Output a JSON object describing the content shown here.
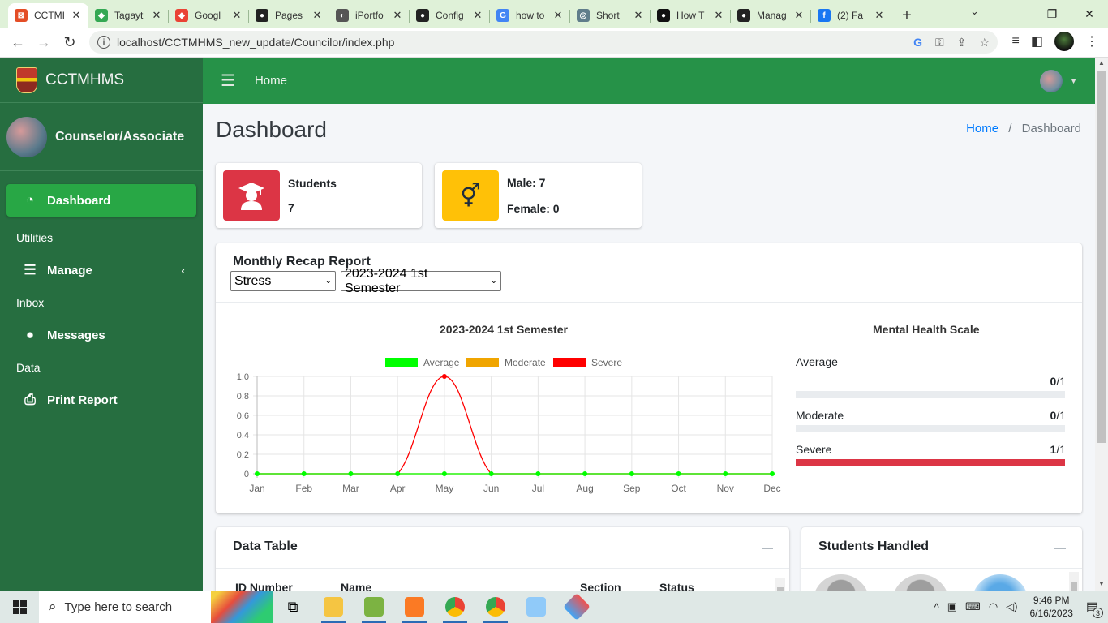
{
  "browser": {
    "tabs": [
      {
        "title": "CCTMI",
        "color": "#e44d26",
        "glyph": "⊠",
        "active": true
      },
      {
        "title": "Tagayt",
        "color": "#34a853",
        "glyph": "◆"
      },
      {
        "title": "Googl",
        "color": "#ea4335",
        "glyph": "◆"
      },
      {
        "title": "Pages",
        "color": "#222222",
        "glyph": "●"
      },
      {
        "title": "iPortfo",
        "color": "#555555",
        "glyph": "◐"
      },
      {
        "title": "Config",
        "color": "#222222",
        "glyph": "●"
      },
      {
        "title": "how to",
        "color": "#4285f4",
        "glyph": "G"
      },
      {
        "title": "Short",
        "color": "#607d8b",
        "glyph": "◎"
      },
      {
        "title": "How T",
        "color": "#111111",
        "glyph": "●"
      },
      {
        "title": "Manag",
        "color": "#222222",
        "glyph": "●"
      },
      {
        "title": "(2) Fa",
        "color": "#1877f2",
        "glyph": "f"
      }
    ],
    "url": "localhost/CCTMHMS_new_update/Councilor/index.php"
  },
  "sidebar": {
    "brand": "CCTMHMS",
    "user": "Counselor/Associate",
    "items": [
      {
        "type": "item",
        "label": "Dashboard",
        "icon": "gauge-icon",
        "glyph": "◔",
        "active": true
      },
      {
        "type": "header",
        "label": "Utilities"
      },
      {
        "type": "item",
        "label": "Manage",
        "icon": "list-icon",
        "glyph": "☰",
        "chevron": "‹"
      },
      {
        "type": "header",
        "label": "Inbox"
      },
      {
        "type": "item",
        "label": "Messages",
        "icon": "comment-icon",
        "glyph": "●"
      },
      {
        "type": "header",
        "label": "Data"
      },
      {
        "type": "item",
        "label": "Print Report",
        "icon": "print-icon",
        "glyph": "⎙"
      }
    ]
  },
  "topnav": {
    "home": "Home"
  },
  "page": {
    "title": "Dashboard",
    "breadcrumb": {
      "home": "Home",
      "current": "Dashboard"
    }
  },
  "infoboxes": {
    "students": {
      "label": "Students",
      "value": "7",
      "color": "#dc3545"
    },
    "gender": {
      "male": "Male: 7",
      "female": "Female: 0",
      "color": "#ffc107"
    }
  },
  "recap": {
    "title": "Monthly Recap Report",
    "select_type": "Stress",
    "select_semester": "2023-2024 1st Semester",
    "chart_title": "2023-2024 1st Semester",
    "scale_title": "Mental Health Scale",
    "scale": [
      {
        "label": "Average",
        "value": "0",
        "total": "/1",
        "fraction": 0
      },
      {
        "label": "Moderate",
        "value": "0",
        "total": "/1",
        "fraction": 0
      },
      {
        "label": "Severe",
        "value": "1",
        "total": "/1",
        "fraction": 1
      }
    ]
  },
  "chart_data": {
    "type": "line",
    "title": "2023-2024 1st Semester",
    "categories": [
      "Jan",
      "Feb",
      "Mar",
      "Apr",
      "May",
      "Jun",
      "Jul",
      "Aug",
      "Sep",
      "Oct",
      "Nov",
      "Dec"
    ],
    "yticks": [
      "0",
      "0.2",
      "0.4",
      "0.6",
      "0.8",
      "1.0"
    ],
    "ylim": [
      0,
      1
    ],
    "series": [
      {
        "name": "Average",
        "color": "#00ff00",
        "values": [
          0,
          0,
          0,
          0,
          0,
          0,
          0,
          0,
          0,
          0,
          0,
          0
        ]
      },
      {
        "name": "Moderate",
        "color": "#f0a500",
        "values": [
          0,
          0,
          0,
          0,
          0,
          0,
          0,
          0,
          0,
          0,
          0,
          0
        ]
      },
      {
        "name": "Severe",
        "color": "#ff0000",
        "values": [
          0,
          0,
          0,
          0,
          1,
          0,
          0,
          0,
          0,
          0,
          0,
          0
        ]
      }
    ],
    "legend": "top",
    "grid": true
  },
  "datatable": {
    "title": "Data Table",
    "columns": [
      "ID Number",
      "Name",
      "Section",
      "Status"
    ]
  },
  "handled": {
    "title": "Students Handled"
  },
  "taskbar": {
    "search_placeholder": "Type here to search",
    "time": "9:46 PM",
    "date": "6/16/2023",
    "notif_count": "3"
  }
}
